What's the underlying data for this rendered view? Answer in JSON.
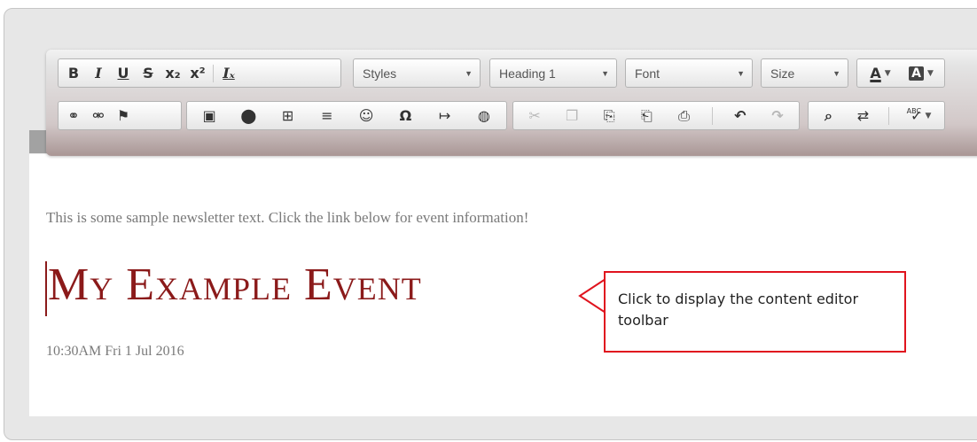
{
  "toolbar": {
    "row1": {
      "basic": [
        {
          "icon": "bold-icon",
          "glyph": "B"
        },
        {
          "icon": "italic-icon",
          "glyph": "I"
        },
        {
          "icon": "underline-icon",
          "glyph": "U"
        },
        {
          "icon": "strikethrough-icon",
          "glyph": "S"
        },
        {
          "icon": "subscript-icon",
          "glyph": "x₂"
        },
        {
          "icon": "superscript-icon",
          "glyph": "x²"
        },
        {
          "icon": "remove-format-icon",
          "glyph": "Iₓ"
        }
      ],
      "styles_label": "Styles",
      "format_label": "Heading 1",
      "font_label": "Font",
      "size_label": "Size",
      "text_color_glyph": "A",
      "bg_color_glyph": "A"
    },
    "row2": {
      "links": [
        {
          "icon": "link-icon",
          "glyph": "⚭"
        },
        {
          "icon": "unlink-icon",
          "glyph": "⚮"
        },
        {
          "icon": "anchor-flag-icon",
          "glyph": "⚑"
        }
      ],
      "insert": [
        {
          "icon": "image-icon",
          "glyph": "▣"
        },
        {
          "icon": "flash-icon",
          "glyph": "⬤"
        },
        {
          "icon": "table-icon",
          "glyph": "⊞"
        },
        {
          "icon": "horizontal-line-icon",
          "glyph": "≡"
        },
        {
          "icon": "smiley-icon",
          "glyph": "☺"
        },
        {
          "icon": "special-char-icon",
          "glyph": "Ω"
        },
        {
          "icon": "page-break-icon",
          "glyph": "↦"
        },
        {
          "icon": "iframe-globe-icon",
          "glyph": "◍"
        }
      ],
      "clipboard": [
        {
          "icon": "cut-icon",
          "glyph": "✂",
          "disabled": true
        },
        {
          "icon": "copy-icon",
          "glyph": "❐",
          "disabled": true
        },
        {
          "icon": "paste-icon",
          "glyph": "⎘"
        },
        {
          "icon": "paste-text-icon",
          "glyph": "⎗"
        },
        {
          "icon": "paste-word-icon",
          "glyph": "⎙"
        },
        {
          "icon": "undo-icon",
          "glyph": "↶"
        },
        {
          "icon": "redo-icon",
          "glyph": "↷",
          "disabled": true
        }
      ],
      "editing": [
        {
          "icon": "find-icon",
          "glyph": "⌕"
        },
        {
          "icon": "replace-icon",
          "glyph": "⇄"
        },
        {
          "icon": "spellcheck-icon",
          "glyph": "✓"
        }
      ]
    }
  },
  "content": {
    "body_text": "This is some sample newsletter text.  Click the link below for event information!",
    "event_title": "My Example Event",
    "event_date": "10:30AM Fri 1 Jul 2016"
  },
  "callout": {
    "text": "Click to display the content editor toolbar"
  },
  "colors": {
    "accent_red": "#8b1a1a",
    "callout_border": "#e0141e"
  }
}
